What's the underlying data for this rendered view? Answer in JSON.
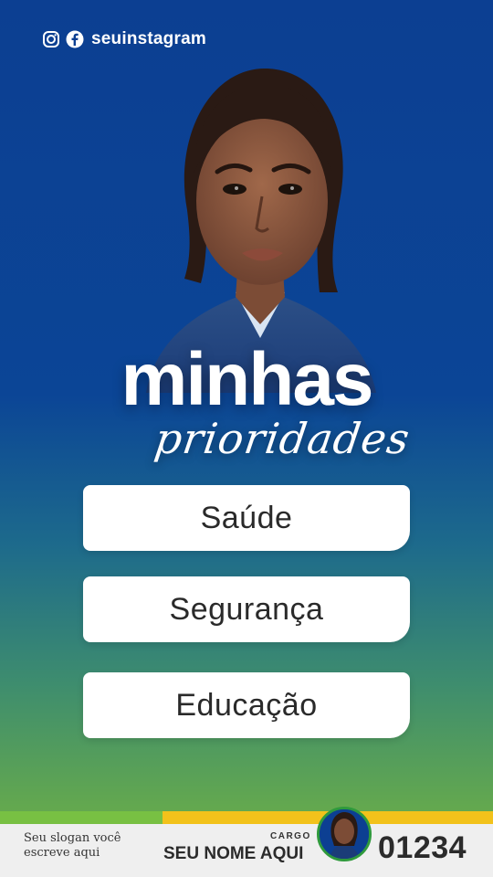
{
  "header": {
    "social_handle": "seuinstagram",
    "icons": [
      "instagram-icon",
      "facebook-icon"
    ]
  },
  "title": {
    "main": "minhas",
    "script": "prioridades"
  },
  "priorities": [
    {
      "label": "Saúde"
    },
    {
      "label": "Segurança"
    },
    {
      "label": "Educação"
    }
  ],
  "footer": {
    "slogan": "Seu slogan você escreve aqui",
    "cargo": "CARGO",
    "name": "SEU NOME AQUI",
    "number": "01234"
  },
  "colors": {
    "background_top": "#0c3f92",
    "background_bottom": "#6aaa4a",
    "stripe_green": "#78c043",
    "stripe_yellow": "#f2c21b",
    "card": "#ffffff",
    "footer": "#efefef"
  }
}
